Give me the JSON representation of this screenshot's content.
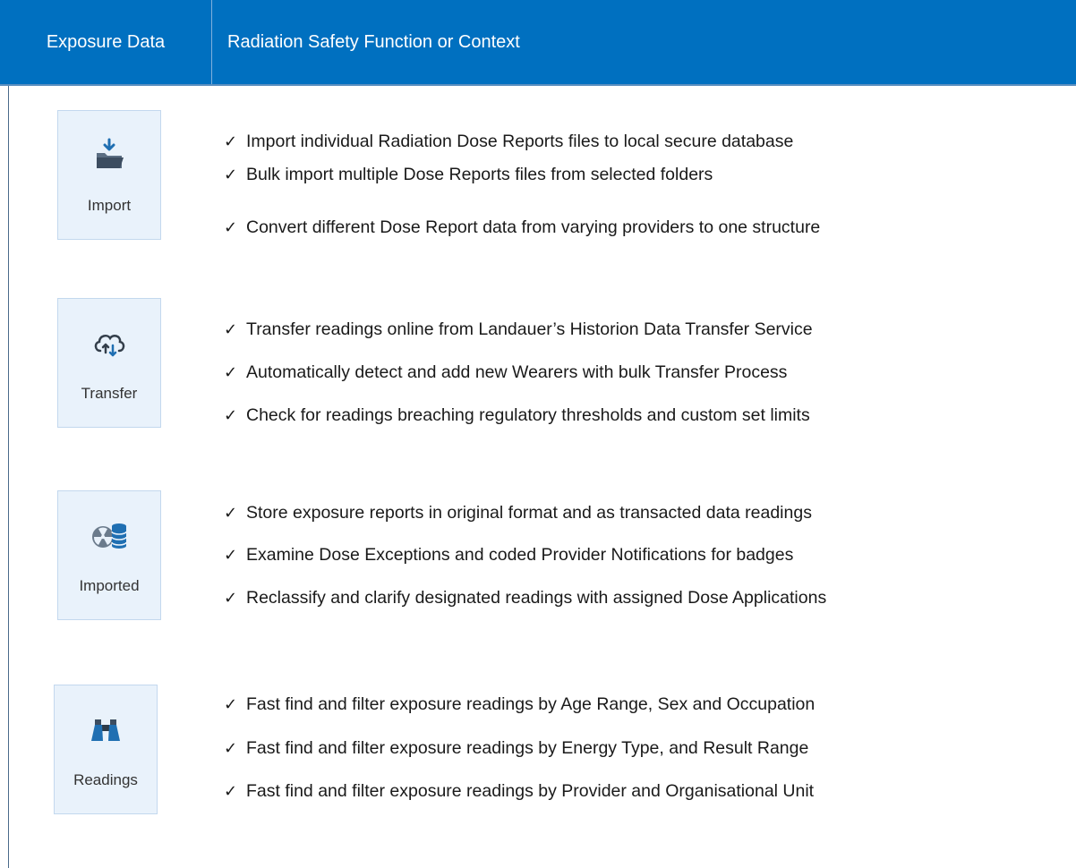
{
  "header": {
    "col1": "Exposure Data",
    "col2": "Radiation Safety Function or Context"
  },
  "check_glyph": "✓",
  "sections": [
    {
      "label": "Import",
      "icon": "folder-import-icon",
      "items": [
        "Import individual Radiation Dose Reports files to local secure database",
        "Bulk import multiple Dose Reports files from selected folders",
        "Convert different Dose Report data from varying providers to one structure"
      ]
    },
    {
      "label": "Transfer",
      "icon": "cloud-transfer-icon",
      "items": [
        "Transfer readings online from Landauer’s Historion Data Transfer Service",
        "Automatically detect and add new Wearers with bulk Transfer Process",
        "Check for readings breaching regulatory thresholds and custom set limits"
      ]
    },
    {
      "label": "Imported",
      "icon": "radiation-database-icon",
      "items": [
        "Store exposure reports in original format and as transacted data readings",
        "Examine Dose Exceptions and coded Provider Notifications for badges",
        "Reclassify and clarify designated readings with assigned Dose Applications"
      ]
    },
    {
      "label": "Readings",
      "icon": "binoculars-icon",
      "items": [
        "Fast find and filter exposure readings by Age Range, Sex and Occupation",
        "Fast find and filter exposure readings by Energy Type, and Result Range",
        "Fast find and filter exposure readings by Provider and Organisational Unit"
      ]
    }
  ]
}
